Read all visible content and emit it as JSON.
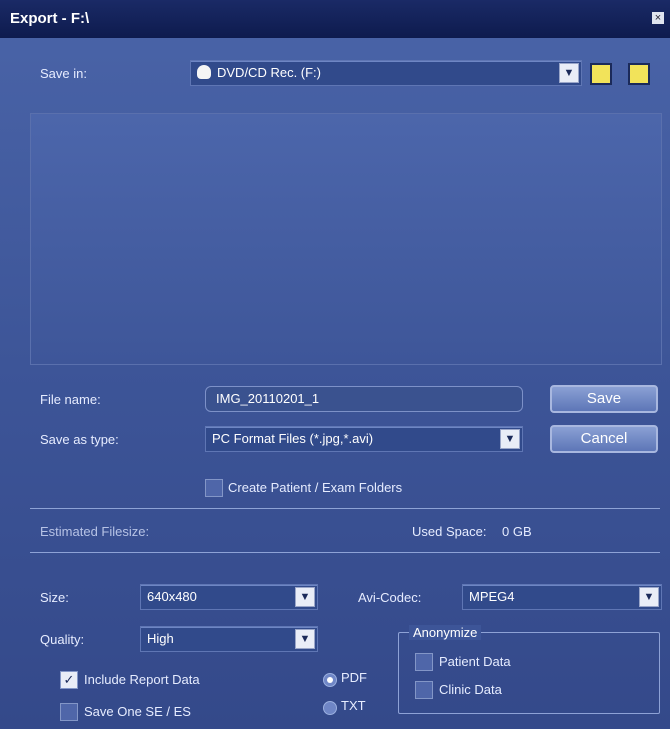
{
  "window": {
    "title": "Export - F:\\",
    "close_glyph": "×"
  },
  "save_in": {
    "label": "Save in:",
    "value": "DVD/CD Rec. (F:)"
  },
  "file": {
    "name_label": "File name:",
    "name_value": "IMG_20110201_1",
    "type_label": "Save as type:",
    "type_value": "PC Format Files (*.jpg,*.avi)",
    "create_folders_label": "Create Patient / Exam Folders"
  },
  "actions": {
    "save_label": "Save",
    "cancel_label": "Cancel"
  },
  "info": {
    "estimated_filesize_label": "Estimated Filesize:",
    "used_space_label": "Used Space:",
    "used_space_value": "0 GB"
  },
  "settings": {
    "size_label": "Size:",
    "size_value": "640x480",
    "quality_label": "Quality:",
    "quality_value": "High",
    "avi_codec_label": "Avi-Codec:",
    "avi_codec_value": "MPEG4",
    "include_report_label": "Include Report Data",
    "save_one_label": "Save One SE / ES",
    "pdf_label": "PDF",
    "txt_label": "TXT",
    "anonymize_title": "Anonymize",
    "patient_data_label": "Patient Data",
    "clinic_data_label": "Clinic Data"
  },
  "icons": {
    "dropdown": "▼",
    "check": "✓",
    "drive_icon": "dvd-drive-icon",
    "up_folder_icon": "folder-up-icon",
    "new_folder_icon": "new-folder-icon"
  },
  "colors": {
    "window_bg": "#3d5598",
    "titlebar": "#0e1b4e",
    "text": "#ffffff"
  }
}
